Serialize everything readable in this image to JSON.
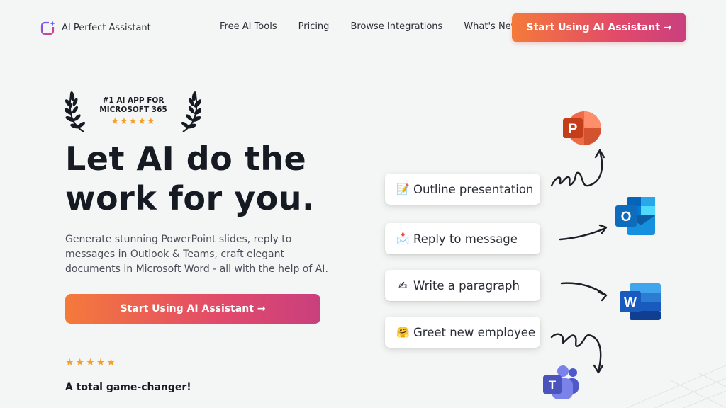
{
  "header": {
    "brand": "AI Perfect Assistant",
    "nav": [
      {
        "label": "Free AI Tools"
      },
      {
        "label": "Pricing"
      },
      {
        "label": "Browse Integrations"
      },
      {
        "label": "What's New",
        "has_dot": true
      }
    ],
    "cta_label": "Start Using AI Assistant →"
  },
  "badge": {
    "line1": "#1 AI APP FOR",
    "line2": "MICROSOFT 365",
    "stars": "★★★★★"
  },
  "hero": {
    "title_line1": "Let AI do the",
    "title_line2": "work for you.",
    "subtitle": "Generate stunning PowerPoint slides, reply to messages in Outlook & Teams, craft elegant documents in Microsoft Word - all with the help of AI.",
    "cta_label": "Start Using AI Assistant →"
  },
  "review": {
    "stars": "★★★★★",
    "title": "A total game-changer!"
  },
  "prompts": [
    {
      "emoji": "📝",
      "label": "Outline presentation"
    },
    {
      "emoji": "📩",
      "label": "Reply to message"
    },
    {
      "emoji": "✍",
      "label": "Write a paragraph"
    },
    {
      "emoji": "🤗",
      "label": "Greet new employee"
    }
  ],
  "apps": [
    {
      "name": "powerpoint-icon",
      "letter": "P",
      "color": "#c43e1c"
    },
    {
      "name": "outlook-icon",
      "letter": "O",
      "color": "#0f6cbd"
    },
    {
      "name": "word-icon",
      "letter": "W",
      "color": "#185abd"
    },
    {
      "name": "teams-icon",
      "letter": "T",
      "color": "#5059c9"
    }
  ],
  "colors": {
    "accent_start": "#f47a3a",
    "accent_end": "#c9407e",
    "star": "#f4a02a",
    "notification_dot": "#e8324a"
  }
}
